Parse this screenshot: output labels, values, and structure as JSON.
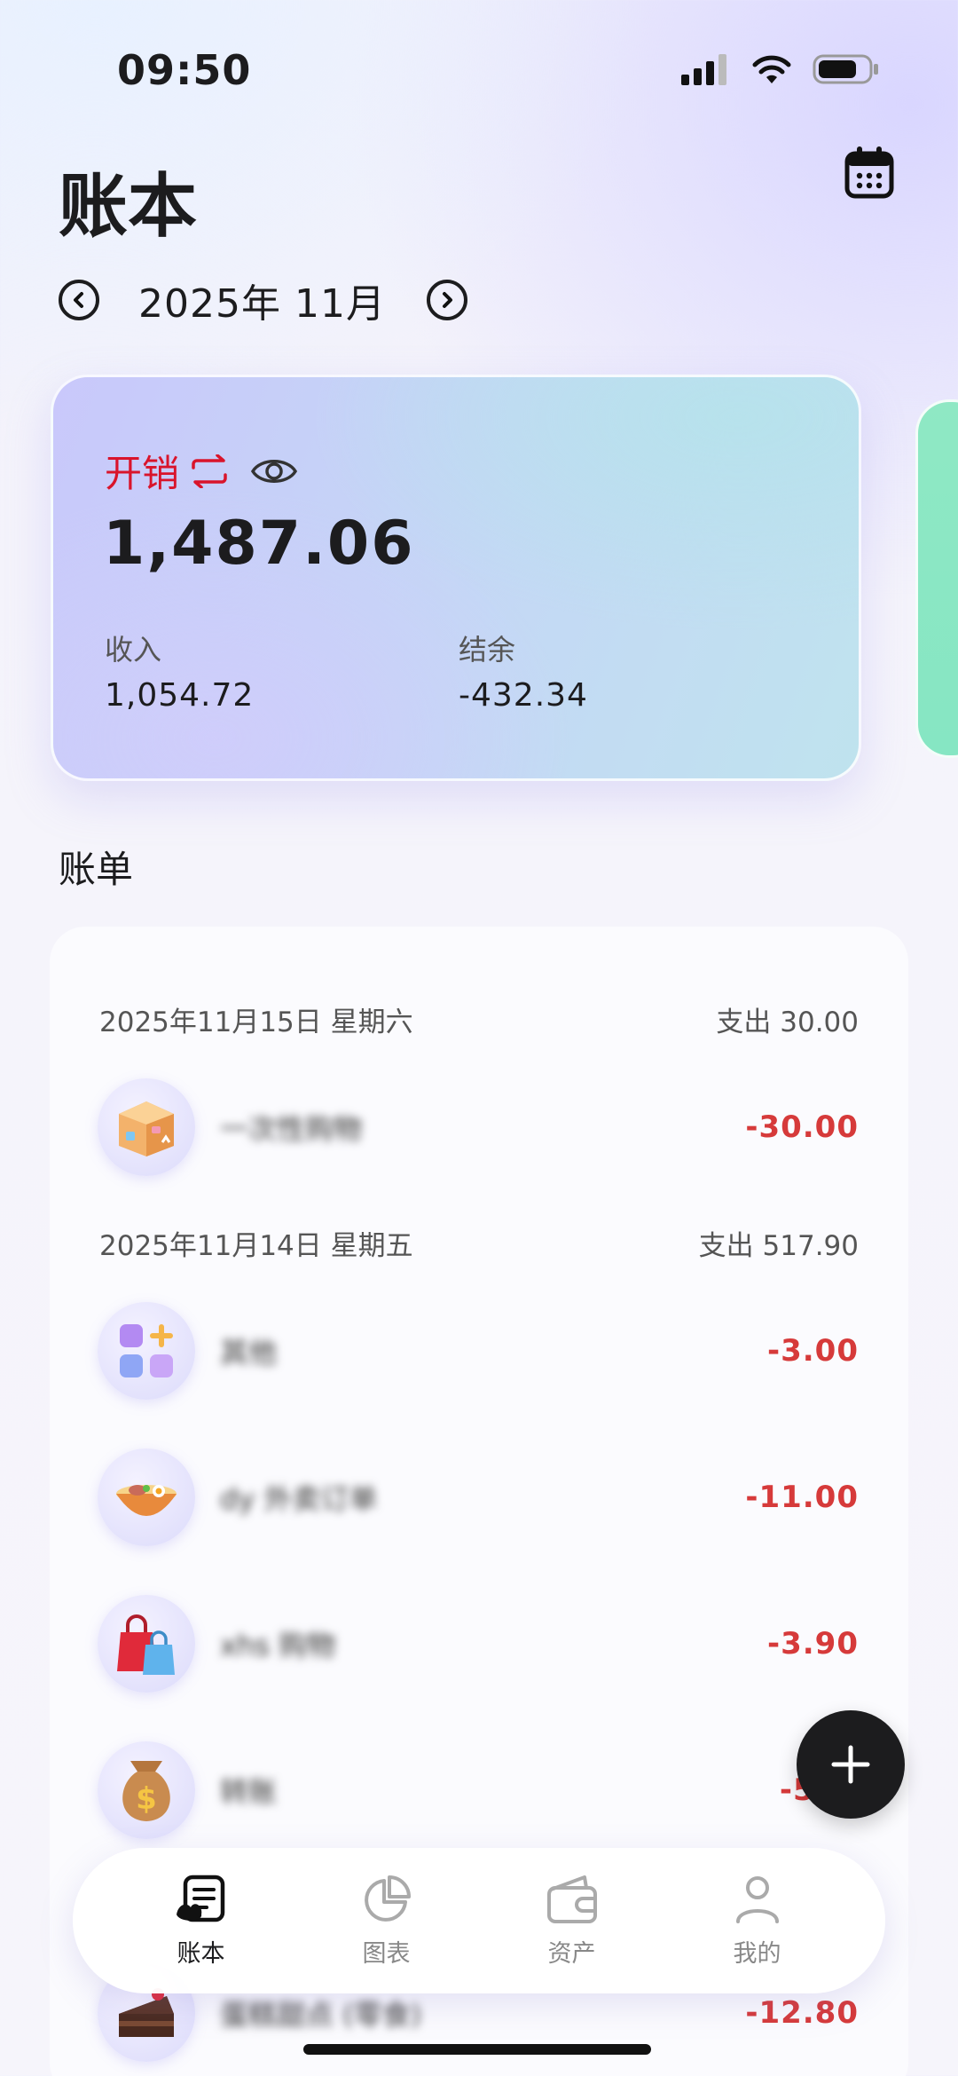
{
  "status_bar": {
    "time": "09:50"
  },
  "header": {
    "title": "账本",
    "month_label": "2025年 11月"
  },
  "summary": {
    "type_label": "开销",
    "amount": "1,487.06",
    "income_label": "收入",
    "income_value": "1,054.72",
    "balance_label": "结余",
    "balance_value": "-432.34"
  },
  "section_title": "账单",
  "days": [
    {
      "date": "2025年11月15日 星期六",
      "total": "支出 30.00"
    },
    {
      "date": "2025年11月14日 星期五",
      "total": "支出 517.90"
    }
  ],
  "bills": [
    {
      "icon": "package-icon",
      "name": "一次性购物",
      "amount": "-30.00"
    },
    {
      "icon": "apps-icon",
      "name": "其他",
      "amount": "-3.00"
    },
    {
      "icon": "noodle-bowl-icon",
      "name": "dy 外卖订单",
      "amount": "-11.00"
    },
    {
      "icon": "shopping-bag-icon",
      "name": "xhs 购物",
      "amount": "-3.90"
    },
    {
      "icon": "money-bag-icon",
      "name": "转账",
      "amount": "-500"
    },
    {
      "icon": "cake-icon",
      "name": "蛋糕甜点 (零食)",
      "amount": "-12.80"
    }
  ],
  "tabs": [
    {
      "label": "账本",
      "icon": "ledger-icon",
      "active": true
    },
    {
      "label": "图表",
      "icon": "pie-chart-icon",
      "active": false
    },
    {
      "label": "资产",
      "icon": "wallet-icon",
      "active": false
    },
    {
      "label": "我的",
      "icon": "person-icon",
      "active": false
    }
  ],
  "colors": {
    "expense_red": "#d63a3a",
    "accent_red": "#d9142b",
    "card_start": "#c9c8fb",
    "card_end": "#bfe3ee",
    "next_card": "#8fe8c4"
  }
}
